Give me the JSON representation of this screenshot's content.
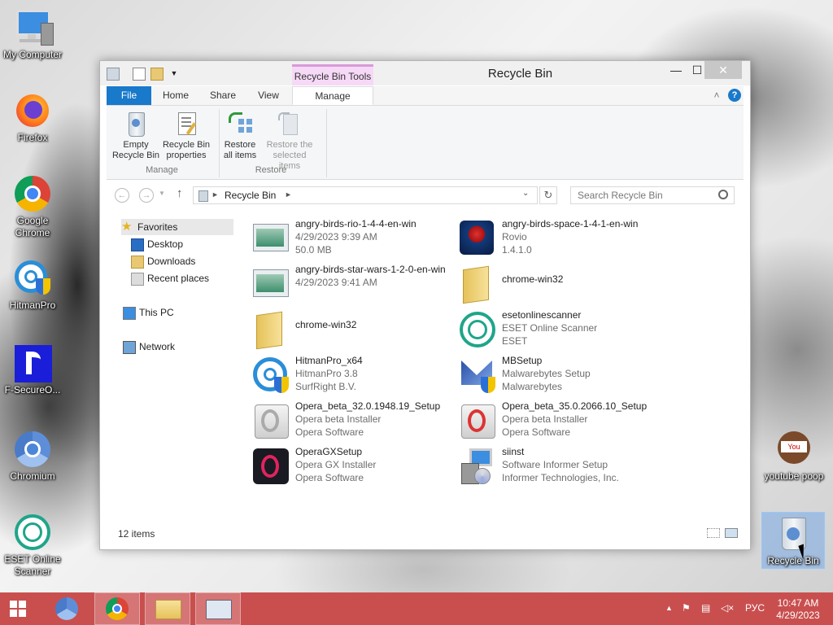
{
  "desktop": {
    "icons": [
      {
        "label": "My Computer"
      },
      {
        "label": "Firefox"
      },
      {
        "label": "Google Chrome"
      },
      {
        "label": "HitmanPro"
      },
      {
        "label": "F-SecureO..."
      },
      {
        "label": "Chromium"
      },
      {
        "label": "ESET Online Scanner"
      },
      {
        "label": "youtube poop"
      },
      {
        "label": "Recycle Bin"
      }
    ]
  },
  "window": {
    "title": "Recycle Bin",
    "context_tab": "Recycle Bin Tools",
    "tabs": {
      "file": "File",
      "home": "Home",
      "share": "Share",
      "view": "View",
      "manage": "Manage"
    },
    "ribbon": {
      "empty": "Empty Recycle Bin",
      "properties": "Recycle Bin properties",
      "group_manage": "Manage",
      "restore_all": "Restore all items",
      "restore_selected": "Restore the selected items",
      "group_restore": "Restore"
    },
    "address": {
      "path": "Recycle Bin",
      "search_placeholder": "Search Recycle Bin"
    },
    "nav": {
      "favorites": "Favorites",
      "desktop": "Desktop",
      "downloads": "Downloads",
      "recent": "Recent places",
      "thispc": "This PC",
      "network": "Network"
    },
    "files": [
      {
        "name": "angry-birds-rio-1-4-4-en-win",
        "line2": "4/29/2023 9:39 AM",
        "line3": "50.0 MB",
        "icon": "installer-icon"
      },
      {
        "name": "angry-birds-space-1-4-1-en-win",
        "line2": "Rovio",
        "line3": "1.4.1.0",
        "icon": "angry-birds-space-icon"
      },
      {
        "name": "angry-birds-star-wars-1-2-0-en-win",
        "line2": "4/29/2023 9:41 AM",
        "line3": "",
        "icon": "installer-icon"
      },
      {
        "name": "chrome-win32",
        "line2": "",
        "line3": "",
        "icon": "folder-icon"
      },
      {
        "name": "chrome-win32",
        "line2": "",
        "line3": "",
        "icon": "folder-icon"
      },
      {
        "name": "esetonlinescanner",
        "line2": "ESET Online Scanner",
        "line3": "ESET",
        "icon": "eset-icon"
      },
      {
        "name": "HitmanPro_x64",
        "line2": "HitmanPro 3.8",
        "line3": "SurfRight B.V.",
        "icon": "hitmanpro-icon"
      },
      {
        "name": "MBSetup",
        "line2": "Malwarebytes Setup",
        "line3": "Malwarebytes",
        "icon": "malwarebytes-icon"
      },
      {
        "name": "Opera_beta_32.0.1948.19_Setup",
        "line2": "Opera beta Installer",
        "line3": "Opera Software",
        "icon": "opera-setup-icon"
      },
      {
        "name": "Opera_beta_35.0.2066.10_Setup",
        "line2": "Opera beta Installer",
        "line3": "Opera Software",
        "icon": "opera-setup-red-icon"
      },
      {
        "name": "OperaGXSetup",
        "line2": "Opera GX Installer",
        "line3": "Opera Software",
        "icon": "opera-gx-icon"
      },
      {
        "name": "siinst",
        "line2": "Software Informer Setup",
        "line3": "Informer Technologies, Inc.",
        "icon": "software-informer-icon"
      }
    ],
    "status": "12 items"
  },
  "taskbar": {
    "lang": "РУС",
    "time": "10:47 AM",
    "date": "4/29/2023"
  }
}
